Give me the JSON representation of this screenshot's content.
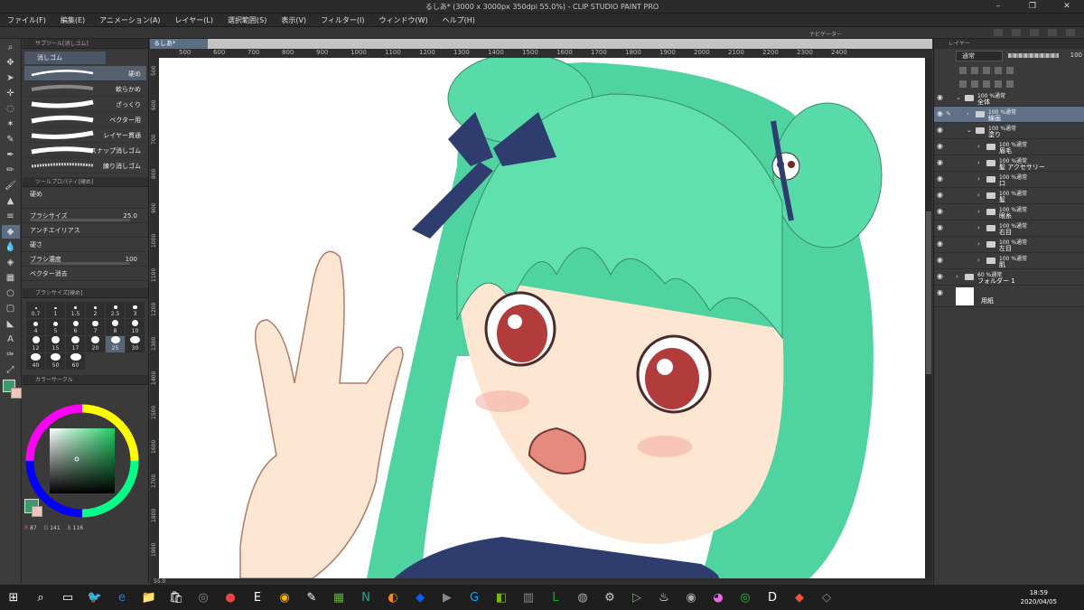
{
  "window": {
    "title": "るしあ* (3000 x 3000px 350dpi 55.0%) - CLIP STUDIO PAINT PRO"
  },
  "menu": [
    "ファイル(F)",
    "編集(E)",
    "アニメーション(A)",
    "レイヤー(L)",
    "選択範囲(S)",
    "表示(V)",
    "フィルター(I)",
    "ウィンドウ(W)",
    "ヘルプ(H)"
  ],
  "subtool": {
    "panel_title": "サブツール[消しゴム]",
    "tab": "消しゴム",
    "brushes": [
      "硬め",
      "軟らかめ",
      "ざっくり",
      "ベクター用",
      "レイヤー貫通",
      "スナップ消しゴム",
      "練り消しゴム"
    ]
  },
  "toolprop": {
    "panel_title": "ツールプロパティ[硬め]",
    "preset": "硬め",
    "brush_size_label": "ブラシサイズ",
    "brush_size_value": "25.0",
    "antialias_label": "アンチエイリアス",
    "hardness_label": "硬さ",
    "density_label": "ブラシ濃度",
    "density_value": "100",
    "vector_label": "ベクター消去"
  },
  "brushsize": {
    "panel_title": "ブラシサイズ[硬め]",
    "sizes": [
      "0.7",
      "1",
      "1.5",
      "2",
      "2.5",
      "3",
      "4",
      "5",
      "6",
      "7",
      "8",
      "10",
      "12",
      "15",
      "17",
      "20",
      "25",
      "30",
      "40",
      "50",
      "60"
    ],
    "selected": "25"
  },
  "colorcircle": {
    "panel_title": "カラーサークル",
    "r": "87",
    "g": "141",
    "b": "116",
    "main_color": "#3f9a6b",
    "sub_color": "#f0c6b8"
  },
  "canvas": {
    "tab": "るしあ*",
    "ruler_top": [
      "500",
      "600",
      "700",
      "800",
      "900",
      "1000",
      "1100",
      "1200",
      "1300",
      "1400",
      "1500",
      "1600",
      "1700",
      "1800",
      "1900",
      "2000",
      "2100",
      "2200",
      "2300",
      "2400"
    ],
    "ruler_left": [
      "500",
      "600",
      "700",
      "800",
      "900",
      "1000",
      "1100",
      "1200",
      "1300",
      "1400",
      "1500",
      "1600",
      "1700",
      "1800",
      "1900"
    ],
    "zoom": "55.0",
    "navigator_title": "ナビゲーター"
  },
  "layers": {
    "panel_title": "レイヤー",
    "blend": "通常",
    "opacity": "100",
    "items": [
      {
        "t1": "100 %通常",
        "t2": "全体",
        "indent": 0,
        "type": "folder"
      },
      {
        "t1": "100 %通常",
        "t2": "線画",
        "indent": 1,
        "type": "layer",
        "selected": true
      },
      {
        "t1": "100 %通常",
        "t2": "塗り",
        "indent": 1,
        "type": "folder"
      },
      {
        "t1": "100 %通常",
        "t2": "眉毛",
        "indent": 2,
        "type": "folder"
      },
      {
        "t1": "100 %通常",
        "t2": "髪 アクセサリー",
        "indent": 2,
        "type": "folder"
      },
      {
        "t1": "100 %通常",
        "t2": "口",
        "indent": 2,
        "type": "folder"
      },
      {
        "t1": "100 %通常",
        "t2": "髪",
        "indent": 2,
        "type": "folder"
      },
      {
        "t1": "100 %通常",
        "t2": "眼糸",
        "indent": 2,
        "type": "folder"
      },
      {
        "t1": "100 %通常",
        "t2": "右目",
        "indent": 2,
        "type": "folder"
      },
      {
        "t1": "100 %通常",
        "t2": "左目",
        "indent": 2,
        "type": "folder"
      },
      {
        "t1": "100 %通常",
        "t2": "肌",
        "indent": 2,
        "type": "folder"
      },
      {
        "t1": "60 %通常",
        "t2": "フォルダー 1",
        "indent": 0,
        "type": "folder"
      },
      {
        "t1": "",
        "t2": "用紙",
        "indent": 0,
        "type": "paper"
      }
    ]
  },
  "taskbar": {
    "time": "18:59",
    "date": "2020/04/05",
    "icons": [
      "windows-icon",
      "search-icon",
      "taskview-icon",
      "twitter-icon",
      "edge-icon",
      "explorer-icon",
      "store-icon",
      "app-icon",
      "record-icon",
      "epic-icon",
      "chrome-icon",
      "clip-icon",
      "minecraft-icon",
      "nox-icon",
      "overwatch-icon",
      "dropbox-icon",
      "media-icon",
      "logitech-icon",
      "nvidia-icon",
      "app2-icon",
      "line-icon",
      "app3-icon",
      "app4-icon",
      "play-icon",
      "steam-icon",
      "app5-icon",
      "app6-icon",
      "app7-icon",
      "d-icon",
      "app8-icon",
      "app9-icon"
    ]
  }
}
